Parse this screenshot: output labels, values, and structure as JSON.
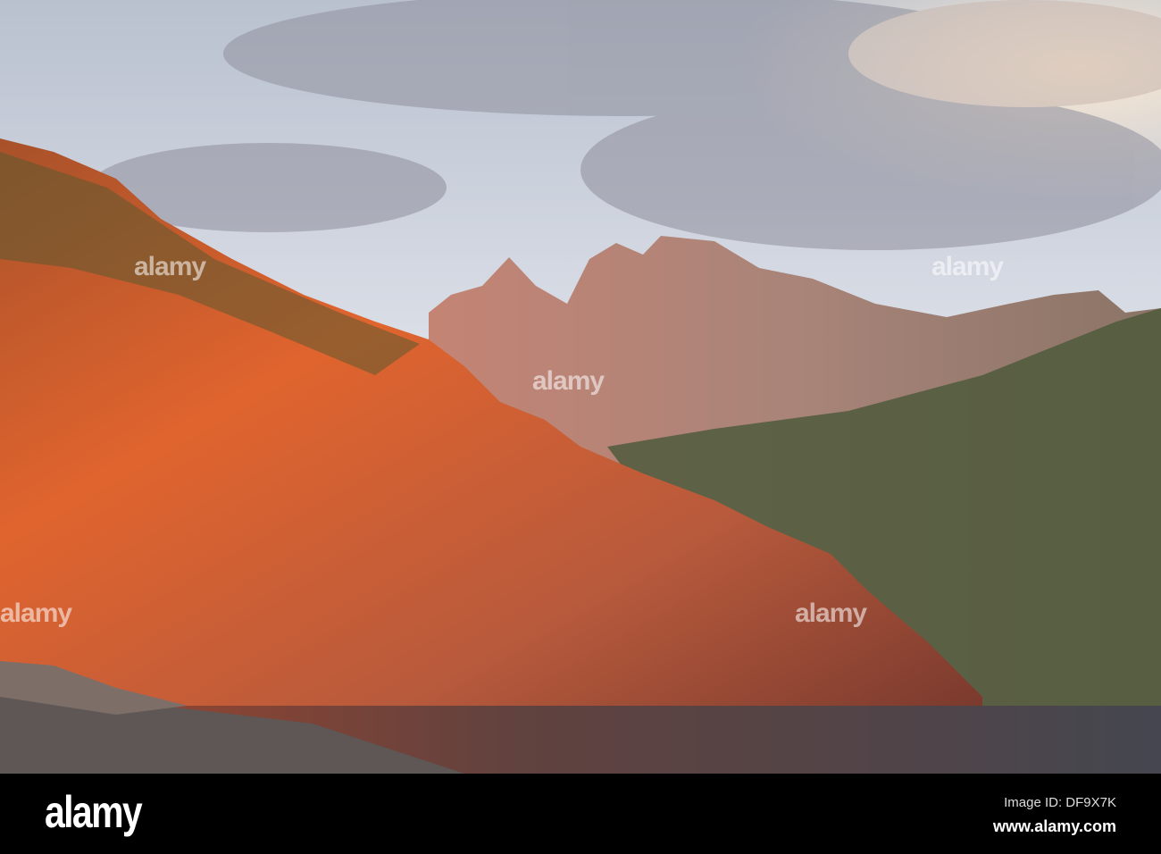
{
  "watermark": {
    "text": "alamy"
  },
  "footer": {
    "logo": "alamy",
    "image_id": "Image ID: DF9X7K",
    "website": "www.alamy.com"
  },
  "colors": {
    "sky_top": "#c9d3e0",
    "cliff": "#d0552a",
    "mountain": "#b98a7c",
    "water": "#4a4a55",
    "bar": "#000000"
  }
}
